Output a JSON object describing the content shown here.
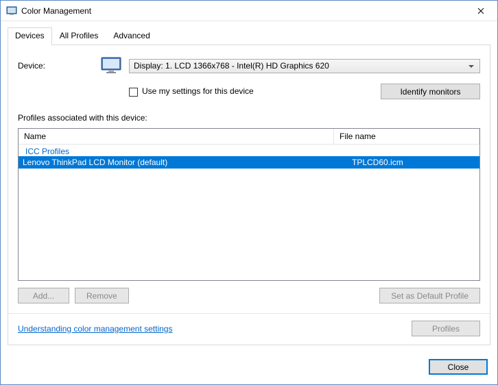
{
  "window": {
    "title": "Color Management"
  },
  "tabs": {
    "devices": "Devices",
    "allprofiles": "All Profiles",
    "advanced": "Advanced"
  },
  "device": {
    "label": "Device:",
    "selected": "Display: 1. LCD 1366x768 - Intel(R) HD Graphics 620",
    "useMySettings": "Use my settings for this device",
    "identify": "Identify monitors"
  },
  "profiles": {
    "heading": "Profiles associated with this device:",
    "columns": {
      "name": "Name",
      "file": "File name"
    },
    "group": "ICC Profiles",
    "rows": [
      {
        "name": "Lenovo ThinkPad LCD Monitor (default)",
        "file": "TPLCD60.icm",
        "selected": true
      }
    ]
  },
  "buttons": {
    "add": "Add...",
    "remove": "Remove",
    "setDefault": "Set as Default Profile",
    "profiles": "Profiles",
    "close": "Close"
  },
  "link": "Understanding color management settings"
}
